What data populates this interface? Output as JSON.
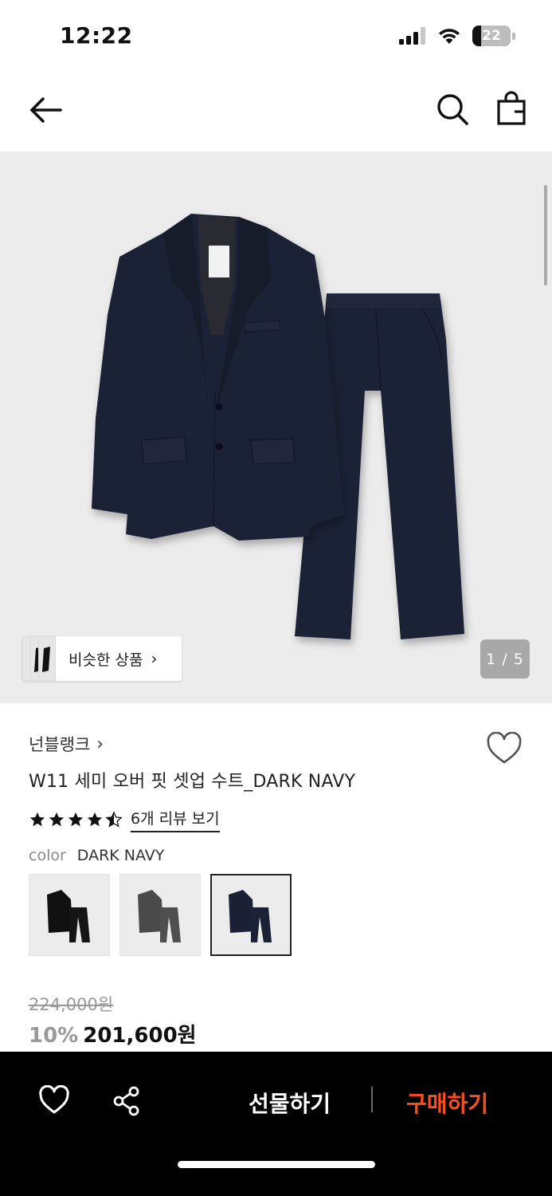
{
  "status_bar": {
    "time": "12:22",
    "battery": "22",
    "battery_level": 0.22,
    "icons": [
      "cellular-signal-icon",
      "wifi-icon",
      "battery-icon"
    ]
  },
  "nav": {
    "icons": [
      "back-arrow-icon",
      "search-icon",
      "shopping-bag-icon"
    ]
  },
  "gallery": {
    "similar_label": "비슷한 상품",
    "similar_chevron": "›",
    "page_indicator": "1 / 5",
    "current_page": 1,
    "total_pages": 5
  },
  "product": {
    "brand": "넌블랭크",
    "brand_chevron": "›",
    "name": "W11 세미 오버 핏 셋업 수트_DARK NAVY",
    "rating": 4.5,
    "review_link": "6개 리뷰 보기",
    "color_label": "color",
    "color_value": "DARK NAVY",
    "swatches": [
      {
        "name": "black",
        "color": "#111111"
      },
      {
        "name": "charcoal",
        "color": "#4a4a4a"
      },
      {
        "name": "dark-navy",
        "color": "#1b2035",
        "selected": true
      }
    ],
    "original_price": "224,000원",
    "discount": "10%",
    "sale_price": "201,600원"
  },
  "bottom_bar": {
    "gift_label": "선물하기",
    "buy_label": "구매하기",
    "accent_color": "#ff4d1a",
    "icons": [
      "heart-icon",
      "share-icon"
    ]
  }
}
